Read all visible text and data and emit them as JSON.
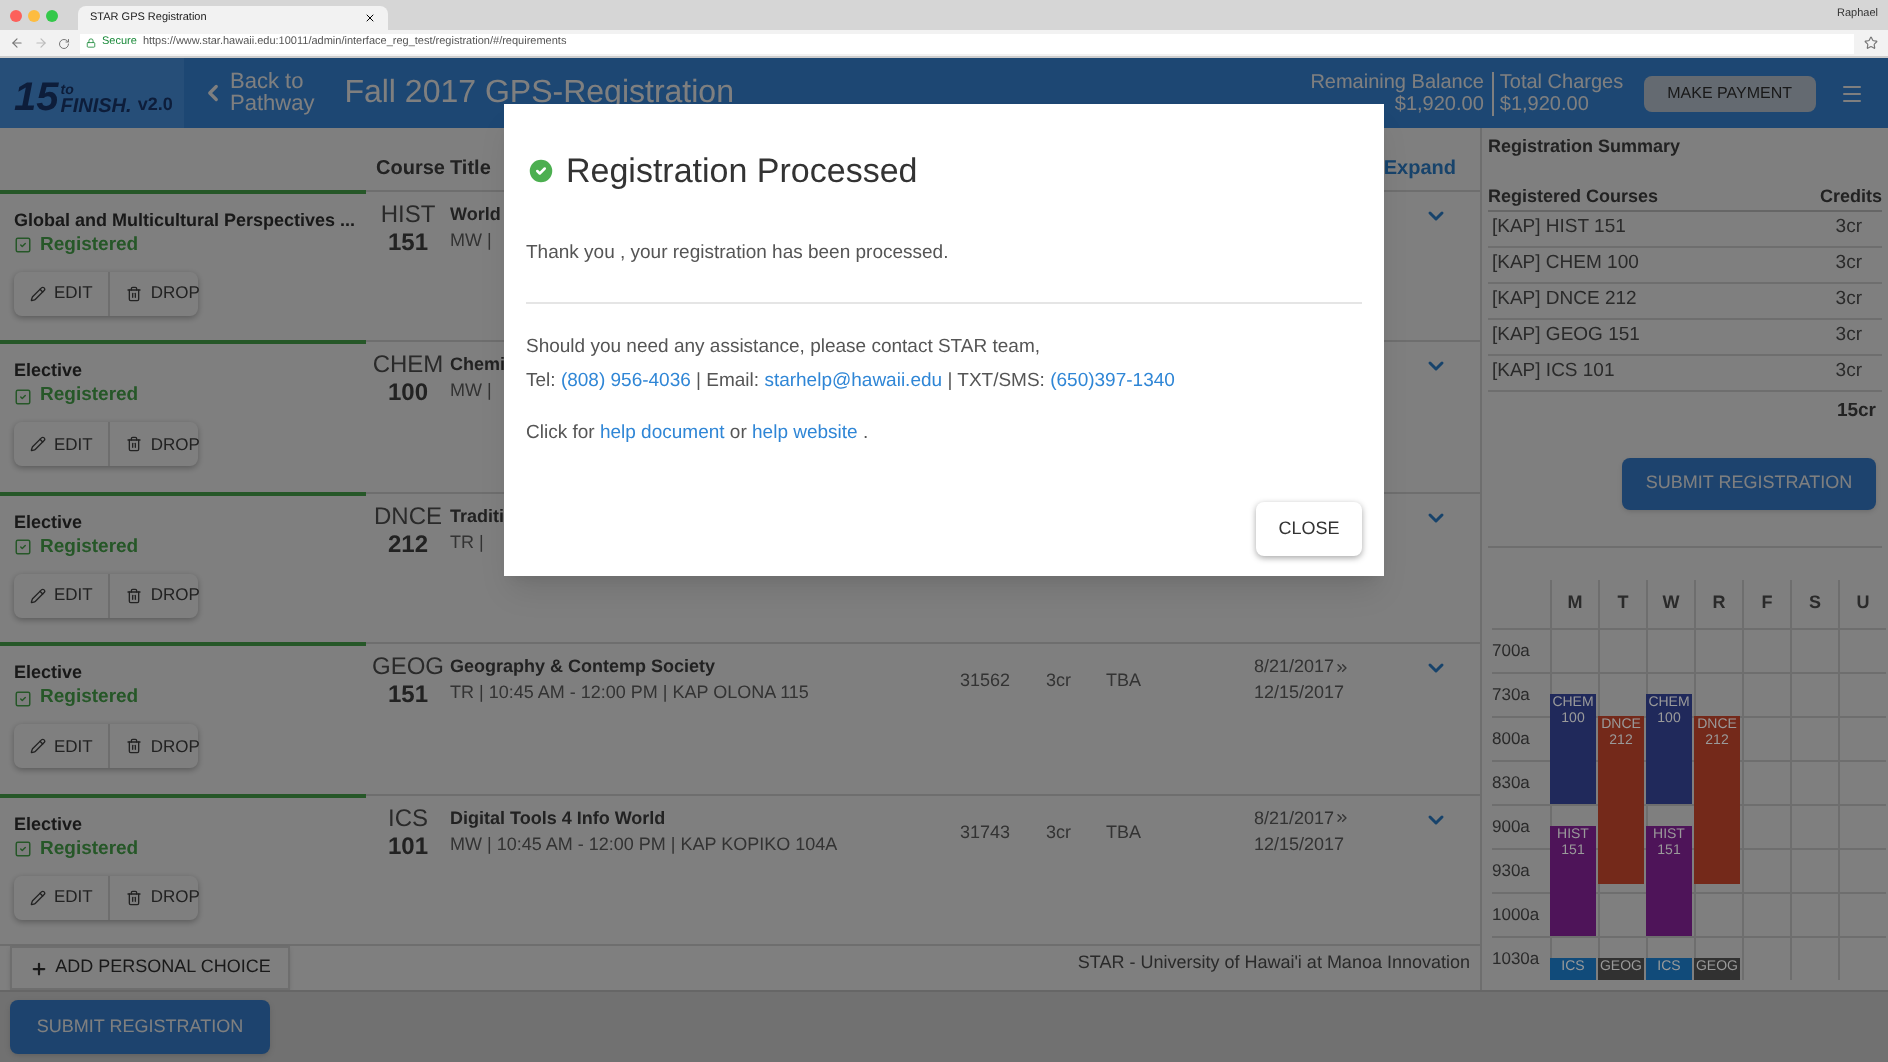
{
  "browser": {
    "tab_title": "STAR GPS Registration",
    "user": "Raphael",
    "secure_label": "Secure",
    "url": "https://www.star.hawaii.edu:10011/admin/interface_reg_test/registration/#/requirements"
  },
  "header": {
    "logo_number": "15",
    "logo_to": "to",
    "logo_word": "FINISH.",
    "version": "v2.0",
    "back_lines": [
      "Back to",
      "Pathway"
    ],
    "title": "Fall 2017 GPS-Registration",
    "balance_label": "Remaining Balance",
    "balance_value": "$1,920.00",
    "charges_label": "Total Charges",
    "charges_value": "$1,920.00",
    "payment_button": "MAKE PAYMENT"
  },
  "table": {
    "columns": [
      "Course",
      "Title",
      "Expand"
    ],
    "rows": [
      {
        "requirement": "Global and Multicultural Perspectives ...",
        "status": "Registered",
        "registered": true,
        "edit": "EDIT",
        "drop": "DROP",
        "subject": "HIST",
        "number": "151",
        "title": "World",
        "meeting": "MW |"
      },
      {
        "requirement": "Elective",
        "status": "Registered",
        "registered": true,
        "edit": "EDIT",
        "drop": "DROP",
        "subject": "CHEM",
        "number": "100",
        "title": "Chemi",
        "meeting": "MW |"
      },
      {
        "requirement": "Elective",
        "status": "Registered",
        "registered": true,
        "edit": "EDIT",
        "drop": "DROP",
        "subject": "DNCE",
        "number": "212",
        "title": "Traditi",
        "meeting": "TR |"
      },
      {
        "requirement": "Elective",
        "status": "Registered",
        "registered": true,
        "edit": "EDIT",
        "drop": "DROP",
        "subject": "GEOG",
        "number": "151",
        "title": "Geography & Contemp Society",
        "meeting": "TR | 10:45 AM - 12:00 PM | KAP OLONA 115",
        "crn": "31562",
        "credits": "3cr",
        "location": "TBA",
        "start_date": "8/21/2017",
        "end_date": "12/15/2017"
      },
      {
        "requirement": "Elective",
        "status": "Registered",
        "registered": true,
        "edit": "EDIT",
        "drop": "DROP",
        "subject": "ICS",
        "number": "101",
        "title": "Digital Tools 4 Info World",
        "meeting": "MW | 10:45 AM - 12:00 PM | KAP KOPIKO 104A",
        "crn": "31743",
        "credits": "3cr",
        "location": "TBA",
        "start_date": "8/21/2017",
        "end_date": "12/15/2017"
      }
    ],
    "add_button": "ADD PERSONAL CHOICE",
    "footer_text": "STAR - University of Hawai'i at Manoa Innovation"
  },
  "summary": {
    "title": "Registration Summary",
    "columns": [
      "Registered Courses",
      "Credits"
    ],
    "rows": [
      {
        "course": "[KAP] HIST 151",
        "credits": "3cr"
      },
      {
        "course": "[KAP] CHEM 100",
        "credits": "3cr"
      },
      {
        "course": "[KAP] DNCE 212",
        "credits": "3cr"
      },
      {
        "course": "[KAP] GEOG 151",
        "credits": "3cr"
      },
      {
        "course": "[KAP] ICS 101",
        "credits": "3cr"
      }
    ],
    "total": "15cr",
    "submit_button": "SUBMIT REGISTRATION"
  },
  "schedule": {
    "days": [
      "M",
      "T",
      "W",
      "R",
      "F",
      "S",
      "U"
    ],
    "times": [
      "700a",
      "730a",
      "800a",
      "830a",
      "900a",
      "930a",
      "1000a",
      "1030a"
    ],
    "events": [
      {
        "line_1": "CHEM",
        "line_2": "100",
        "color": "#20295b"
      },
      {
        "line_1": "CHEM",
        "line_2": "100",
        "color": "#20295b"
      },
      {
        "line_1": "DNCE",
        "line_2": "212",
        "color": "#74291a"
      },
      {
        "line_1": "DNCE",
        "line_2": "212",
        "color": "#74291a"
      },
      {
        "line_1": "HIST",
        "line_2": "151",
        "color": "#4e1459"
      },
      {
        "line_1": "HIST",
        "line_2": "151",
        "color": "#4e1459"
      },
      {
        "line_1": "ICS",
        "color": "#114b7a"
      },
      {
        "line_1": "GEOG",
        "color": "#313131"
      },
      {
        "line_1": "ICS",
        "color": "#114b7a"
      },
      {
        "line_1": "GEOG",
        "color": "#313131"
      }
    ]
  },
  "bottom_bar": {
    "submit_button": "SUBMIT REGISTRATION"
  },
  "modal": {
    "title": "Registration Processed",
    "message": "Thank you , your registration has been processed.",
    "assistance": "Should you need any assistance, please contact STAR team,",
    "contact": [
      {
        "kind": "text",
        "text": "Tel: "
      },
      {
        "kind": "link",
        "text": "(808) 956-4036"
      },
      {
        "kind": "text",
        "text": " | Email: "
      },
      {
        "kind": "link",
        "text": "starhelp@hawaii.edu"
      },
      {
        "kind": "text",
        "text": " | TXT/SMS: "
      },
      {
        "kind": "link",
        "text": "(650)397-1340"
      }
    ],
    "help": [
      {
        "kind": "text",
        "text": "Click for "
      },
      {
        "kind": "link",
        "text": "help document"
      },
      {
        "kind": "text",
        "text": " or "
      },
      {
        "kind": "link",
        "text": "help website"
      },
      {
        "kind": "text",
        "text": " ."
      }
    ],
    "close_button": "CLOSE"
  }
}
